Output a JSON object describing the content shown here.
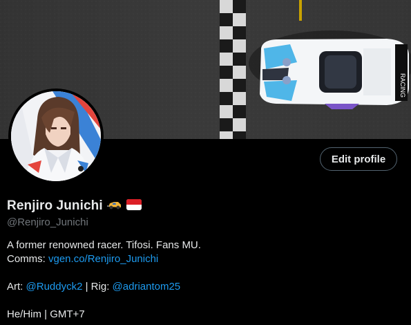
{
  "profile": {
    "display_name": "Renjiro Junichi",
    "handle": "@Renjiro_Junichi",
    "edit_button": "Edit profile",
    "bio": {
      "line1": "A former renowned racer. Tifosi. Fans MU.",
      "comms_label": "Comms: ",
      "comms_link": "vgen.co/Renjiro_Junichi",
      "art_label": "Art: ",
      "art_link": "@Ruddyck2",
      "rig_sep": " | Rig: ",
      "rig_link": "@adriantom25",
      "pronouns_tz": "He/Him | GMT+7"
    },
    "name_emojis": [
      "racing-car-emoji",
      "indonesia-flag"
    ]
  },
  "colors": {
    "background": "#000000",
    "text": "#e7e9ea",
    "muted": "#71767b",
    "link": "#1d9bf0",
    "button_border": "#536471"
  }
}
